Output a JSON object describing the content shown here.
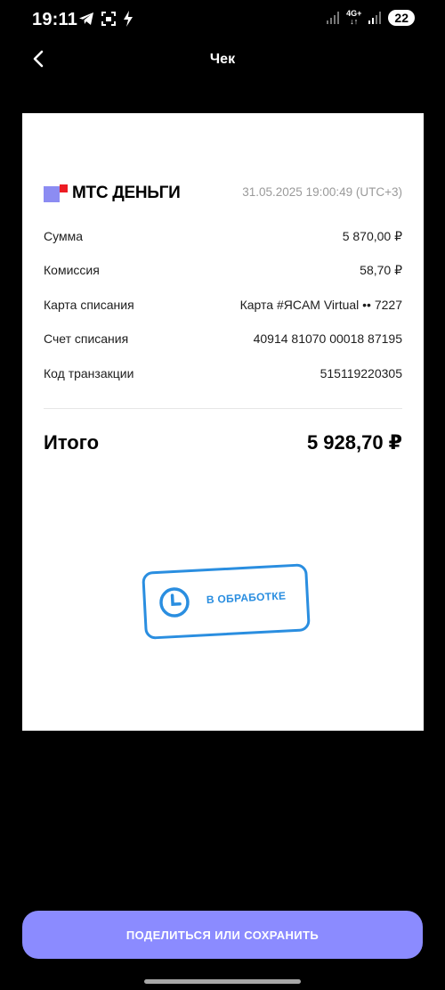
{
  "status_bar": {
    "time": "19:11",
    "network_label": "4G+",
    "battery": "22",
    "icons": [
      "telegram-icon",
      "screenshot-icon",
      "flash-icon",
      "signal-icon",
      "signal-icon"
    ]
  },
  "header": {
    "back_icon": "chevron-left-icon",
    "title": "Чек"
  },
  "receipt": {
    "brand": "МТС ДЕНЬГИ",
    "brand_colors": {
      "blue": "#8c8cf2",
      "red": "#ec1c24"
    },
    "datetime": "31.05.2025 19:00:49 (UTC+3)",
    "rows": [
      {
        "label": "Сумма",
        "value": "5 870,00 ₽"
      },
      {
        "label": "Комиссия",
        "value": "58,70 ₽"
      },
      {
        "label": "Карта списания",
        "value": "Карта #ЯCAM Virtual •• 7227"
      },
      {
        "label": "Счет списания",
        "value": "40914 81070 00018 87195"
      },
      {
        "label": "Код транзакции",
        "value": "515119220305"
      }
    ],
    "total_label": "Итого",
    "total_value": "5 928,70 ₽",
    "stamp": {
      "text": "В ОБРАБОТКЕ",
      "icon": "clock-icon",
      "color": "#2a8ee0"
    }
  },
  "actions": {
    "share_label": "ПОДЕЛИТЬСЯ ИЛИ СОХРАНИТЬ",
    "accent_color": "#8b8bff"
  }
}
